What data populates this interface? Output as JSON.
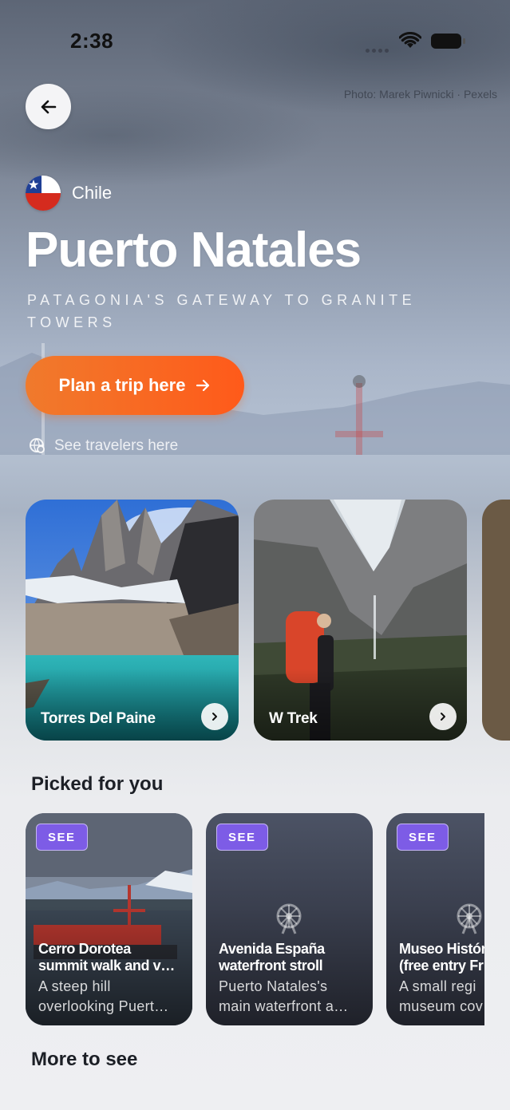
{
  "status_bar": {
    "time": "2:38"
  },
  "photo_credit": "Photo: Marek Piwnicki · Pexels",
  "header": {
    "country": "Chile",
    "title": "Puerto Natales",
    "subtitle": "Patagonia's gateway to granite towers"
  },
  "actions": {
    "plan_trip_label": "Plan a trip here",
    "see_travelers_label": "See travelers here"
  },
  "hero_cards": [
    {
      "label": "Torres Del Paine"
    },
    {
      "label": "W Trek"
    }
  ],
  "picked_section": {
    "title": "Picked for you",
    "cards": [
      {
        "badge": "SEE",
        "title_lines": [
          "Cerro Dorotea",
          "summit walk and v…"
        ],
        "desc_lines": [
          "A steep hill",
          "overlooking Puert…"
        ]
      },
      {
        "badge": "SEE",
        "title_lines": [
          "Avenida España",
          "waterfront stroll"
        ],
        "desc_lines": [
          "Puerto Natales's",
          "main waterfront a…"
        ]
      },
      {
        "badge": "SEE",
        "title_lines": [
          "Museo Históri",
          "(free entry Fr"
        ],
        "desc_lines": [
          "A small regi",
          "museum cov"
        ]
      }
    ]
  },
  "more_section": {
    "title": "More to see"
  },
  "colors": {
    "accent": "#ff5a1a",
    "badge": "#7d5ce6"
  }
}
